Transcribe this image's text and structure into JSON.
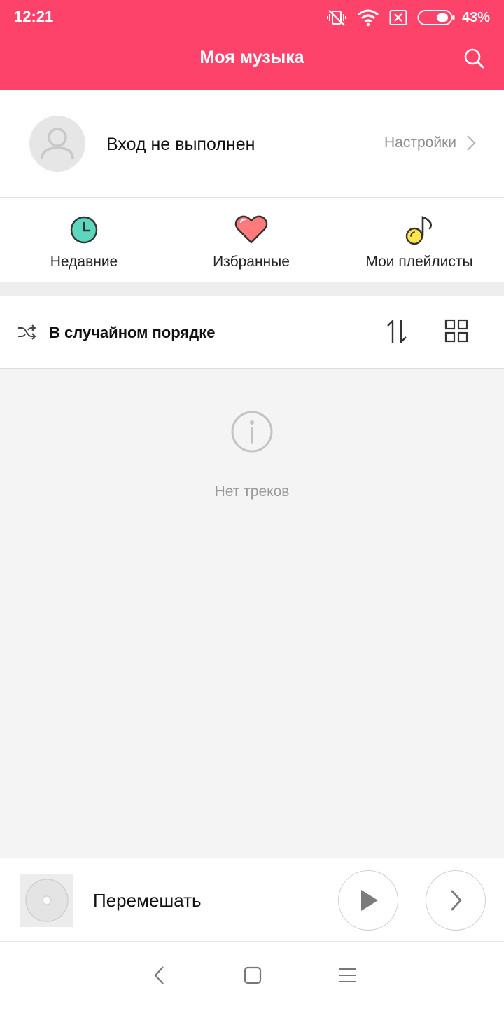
{
  "status_bar": {
    "time": "12:21",
    "battery_percent": "43%",
    "icons": [
      "vibrate-off-icon",
      "wifi-icon",
      "no-sim-icon",
      "battery-icon"
    ]
  },
  "header": {
    "title": "Моя музыка",
    "icon": "search-icon"
  },
  "profile": {
    "login_status": "Вход не выполнен",
    "settings_label": "Настройки"
  },
  "shortcuts": [
    {
      "label": "Недавние",
      "icon": "clock-icon",
      "color": "#5dd6c0"
    },
    {
      "label": "Избранные",
      "icon": "heart-icon",
      "color": "#ff7b7b"
    },
    {
      "label": "Мои плейлисты",
      "icon": "music-note-icon",
      "color": "#ffe34d"
    }
  ],
  "toolbar": {
    "shuffle_label": "В случайном порядке"
  },
  "empty_state": {
    "message": "Нет треков"
  },
  "player": {
    "track_label": "Перемешать"
  },
  "colors": {
    "accent": "#fd4369",
    "content_background": "#f4f4f4"
  }
}
